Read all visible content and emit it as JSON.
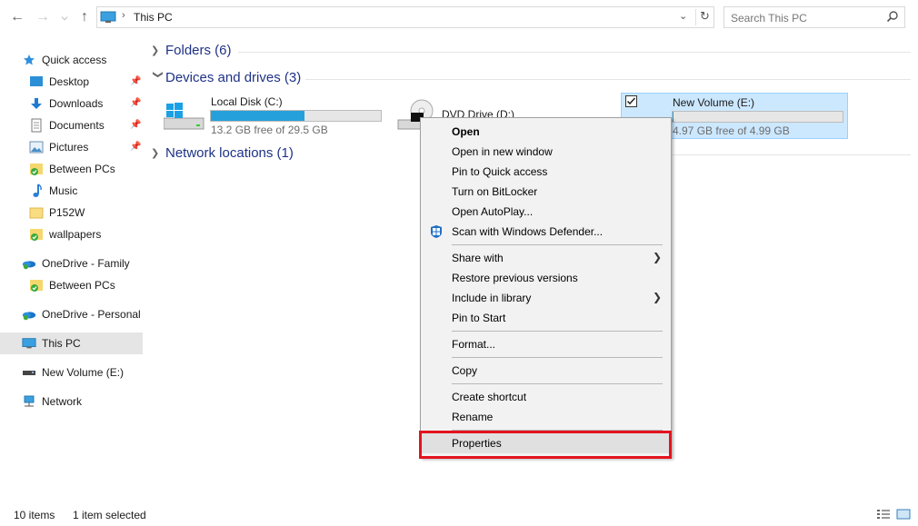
{
  "address": {
    "crumb": "This PC",
    "search_placeholder": "Search This PC"
  },
  "sidebar": {
    "items": [
      {
        "label": "Quick access",
        "icon": "star-icon"
      },
      {
        "label": "Desktop",
        "icon": "desktop-folder-icon",
        "pinned": true
      },
      {
        "label": "Downloads",
        "icon": "download-arrow-icon",
        "pinned": true
      },
      {
        "label": "Documents",
        "icon": "documents-icon",
        "pinned": true
      },
      {
        "label": "Pictures",
        "icon": "pictures-icon",
        "pinned": true
      },
      {
        "label": "Between PCs",
        "icon": "synced-folder-icon"
      },
      {
        "label": "Music",
        "icon": "music-note-icon"
      },
      {
        "label": "P152W",
        "icon": "folder-icon"
      },
      {
        "label": "wallpapers",
        "icon": "synced-folder-icon"
      },
      {
        "label": "OneDrive - Family",
        "icon": "onedrive-icon"
      },
      {
        "label": "Between PCs",
        "icon": "synced-folder-icon"
      },
      {
        "label": "OneDrive - Personal",
        "icon": "onedrive-icon"
      },
      {
        "label": "This PC",
        "icon": "computer-icon"
      },
      {
        "label": "New Volume (E:)",
        "icon": "usb-drive-icon"
      },
      {
        "label": "Network",
        "icon": "network-icon"
      }
    ]
  },
  "groups": {
    "folders": "Folders (6)",
    "devices": "Devices and drives (3)",
    "network": "Network locations (1)"
  },
  "drives": {
    "c": {
      "name": "Local Disk (C:)",
      "free": "13.2 GB free of 29.5 GB",
      "used_fraction": 0.55
    },
    "d": {
      "name": "DVD Drive (D:)"
    },
    "e": {
      "name": "New Volume (E:)",
      "free": "4.97 GB free of 4.99 GB",
      "used_fraction": 0.004
    }
  },
  "context_menu": {
    "items": [
      {
        "label": "Open",
        "bold": true
      },
      {
        "label": "Open in new window"
      },
      {
        "label": "Pin to Quick access"
      },
      {
        "label": "Turn on BitLocker"
      },
      {
        "label": "Open AutoPlay..."
      },
      {
        "label": "Scan with Windows Defender...",
        "icon": "windows-defender-icon"
      },
      {
        "label": "Share with",
        "submenu": true
      },
      {
        "label": "Restore previous versions"
      },
      {
        "label": "Include in library",
        "submenu": true
      },
      {
        "label": "Pin to Start"
      },
      {
        "label": "Format..."
      },
      {
        "label": "Copy"
      },
      {
        "label": "Create shortcut"
      },
      {
        "label": "Rename"
      },
      {
        "label": "Properties",
        "highlighted": true
      }
    ]
  },
  "status": {
    "items": "10 items",
    "selected": "1 item selected"
  },
  "colors": {
    "accent": "#26a0da",
    "selection": "#cce8ff",
    "highlight_box": "#e3131f",
    "group_heading": "#1e3287"
  }
}
